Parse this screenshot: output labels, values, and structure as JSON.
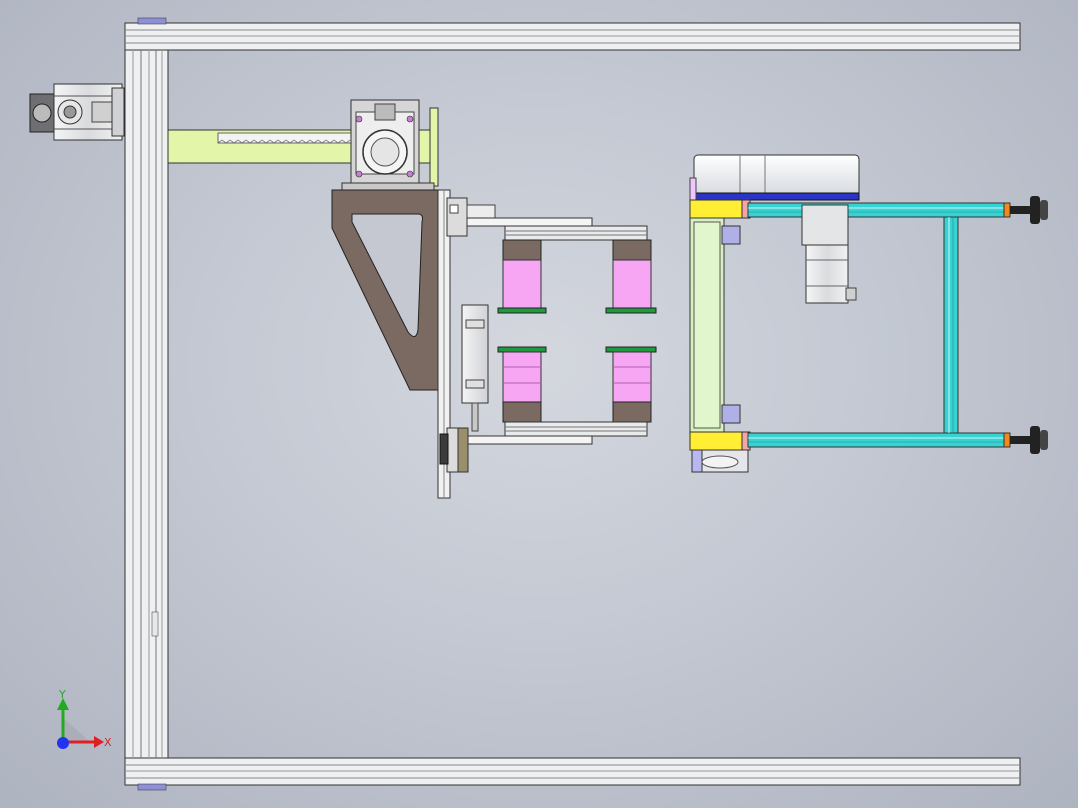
{
  "viewport": {
    "background": "#c9cdd6",
    "view_orientation": "Top"
  },
  "colors": {
    "frame_aluminum": "#eef0f2",
    "frame_groove": "#9aa0a8",
    "arm_green": "#e3f5a8",
    "carriage_green": "#d8f0c0",
    "cyan_rail": "#37d3d3",
    "yellow_block": "#ffee33",
    "magenta_roller": "#f7a6f3",
    "bracket_brown": "#7a6a62",
    "motor_gray": "#d7d9dc",
    "blue_band": "#2a35c8",
    "orange_cap": "#f08a1a",
    "black_foot": "#222222",
    "axis_x": "#e02020",
    "axis_y": "#22aa22",
    "axis_z": "#2233ee"
  },
  "triad": {
    "x_label": "X",
    "y_label": "Y"
  }
}
